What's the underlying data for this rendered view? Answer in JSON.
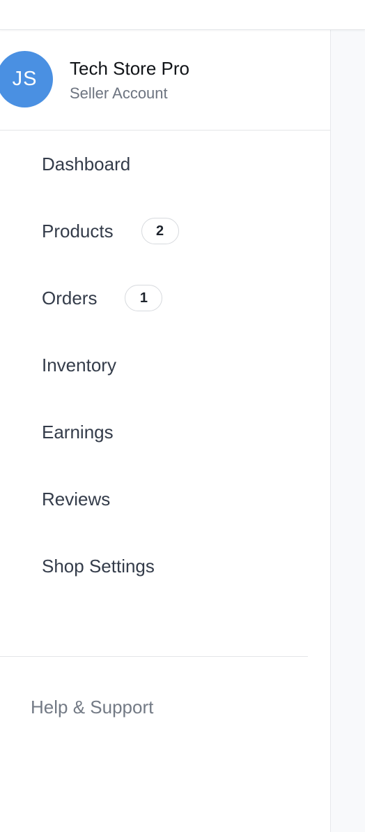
{
  "profile": {
    "avatar_initials": "JS",
    "store_name": "Tech Store Pro",
    "account_type": "Seller Account"
  },
  "nav": {
    "items": [
      {
        "label": "Dashboard",
        "badge": null
      },
      {
        "label": "Products",
        "badge": "2"
      },
      {
        "label": "Orders",
        "badge": "1"
      },
      {
        "label": "Inventory",
        "badge": null
      },
      {
        "label": "Earnings",
        "badge": null
      },
      {
        "label": "Reviews",
        "badge": null
      },
      {
        "label": "Shop Settings",
        "badge": null
      }
    ]
  },
  "footer": {
    "help_label": "Help & Support"
  },
  "colors": {
    "avatar_bg": "#4a90e2",
    "content_bg": "#f8f9fb"
  }
}
